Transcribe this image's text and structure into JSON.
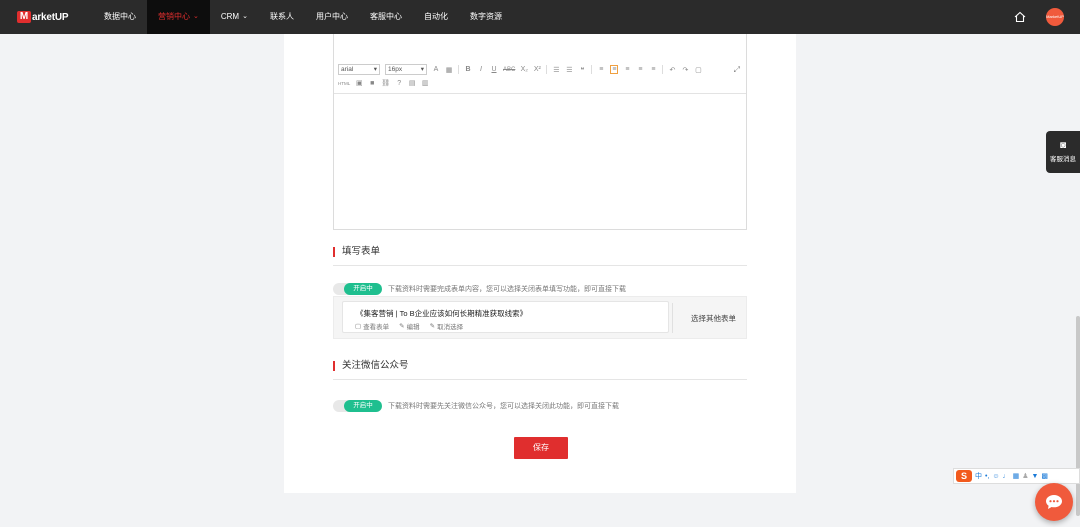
{
  "nav": {
    "logo_mark": "M",
    "logo_text": "arketUP",
    "items": [
      {
        "label": "数据中心"
      },
      {
        "label": "营销中心"
      },
      {
        "label": "CRM"
      },
      {
        "label": "联系人"
      },
      {
        "label": "用户中心"
      },
      {
        "label": "客服中心"
      },
      {
        "label": "自动化"
      },
      {
        "label": "数字资源"
      }
    ],
    "active_index": 1,
    "avatar_text": "MarketUP"
  },
  "editor": {
    "font_family": "arial",
    "font_size": "16px",
    "toolbar_row1": [
      "A",
      "▦",
      "B",
      "I",
      "U",
      "ABC",
      "X₂",
      "X²",
      "☰",
      "☰",
      "❝",
      "≡",
      "≡",
      "≡",
      "≡",
      "≡",
      "↶",
      "↷",
      "▢"
    ],
    "toolbar_row2": [
      "HTML",
      "▣",
      "■",
      "⛓",
      "?",
      "▤",
      "▥"
    ]
  },
  "form_section": {
    "title": "填写表单",
    "toggle_label": "开启中",
    "hint": "下载资料时需要完成表单内容，您可以选择关闭表单填写功能，即可直接下载",
    "form_name": "《集客营销 | To B企业应该如何长期精准获取线索》",
    "actions": {
      "view": "查看表单",
      "edit": "编辑",
      "cancel": "取消选择"
    },
    "choose_other": "选择其他表单"
  },
  "wechat_section": {
    "title": "关注微信公众号",
    "toggle_label": "开启中",
    "hint": "下载资料时需要先关注微信公众号，您可以选择关闭此功能，即可直接下载"
  },
  "save_label": "保存",
  "side_widget": {
    "label": "客服消息"
  },
  "ime": {
    "logo": "S",
    "lang": "中"
  },
  "colors": {
    "brand": "#e02e2e",
    "toggle_on": "#1fbf8f",
    "nav_bg": "#2b2b2b"
  }
}
